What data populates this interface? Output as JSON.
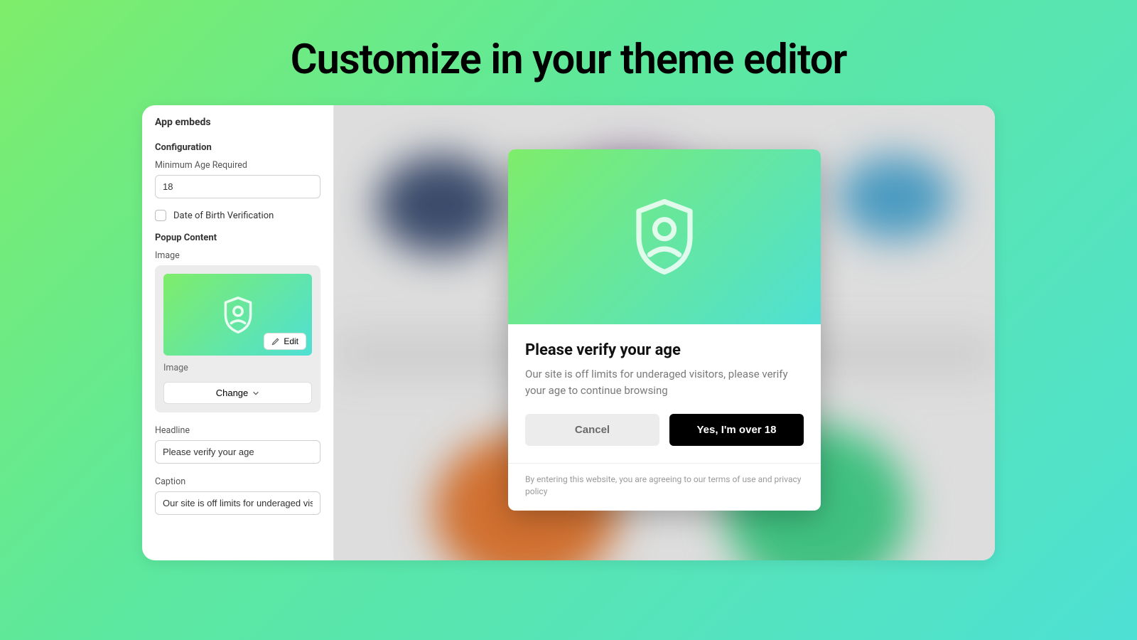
{
  "hero": {
    "title": "Customize in your theme editor"
  },
  "sidebar": {
    "app_embeds": "App embeds",
    "configuration": "Configuration",
    "min_age_label": "Minimum Age Required",
    "min_age_value": "18",
    "dob_checkbox_label": "Date of Birth Verification",
    "popup_content": "Popup Content",
    "image_label": "Image",
    "edit_label": "Edit",
    "image_sublabel": "Image",
    "change_label": "Change",
    "headline_label": "Headline",
    "headline_value": "Please verify your age",
    "caption_label": "Caption",
    "caption_value": "Our site is off limits for underaged visitc"
  },
  "popup": {
    "title": "Please verify your age",
    "caption": "Our site is off limits for underaged visitors, please verify your age to continue browsing",
    "cancel": "Cancel",
    "confirm": "Yes, I'm over 18",
    "footer": "By entering this website, you are agreeing to our terms of use and privacy policy"
  }
}
